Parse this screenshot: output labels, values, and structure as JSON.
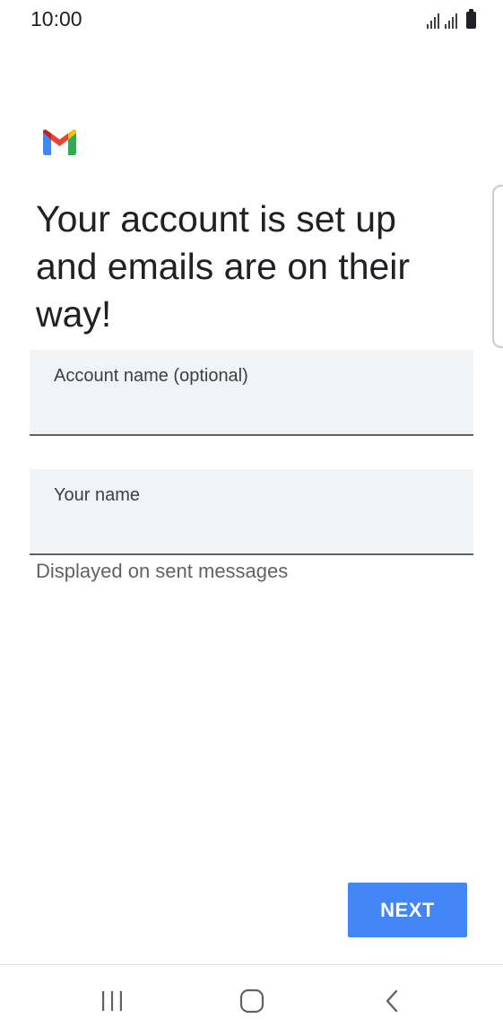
{
  "status_bar": {
    "time": "10:00"
  },
  "app": {
    "logo_icon": "gmail-logo-icon",
    "colors": {
      "accent": "#4285f4",
      "field_background": "#f1f3f4"
    }
  },
  "page": {
    "title": "Your account is set up and emails are on their way!"
  },
  "form": {
    "account_name": {
      "label": "Account name (optional)",
      "value": ""
    },
    "your_name": {
      "label": "Your name",
      "value": "",
      "helper": "Displayed on sent messages"
    }
  },
  "actions": {
    "next_label": "NEXT"
  },
  "nav": {
    "recents_icon": "recents-icon",
    "home_icon": "home-icon",
    "back_icon": "back-icon"
  }
}
